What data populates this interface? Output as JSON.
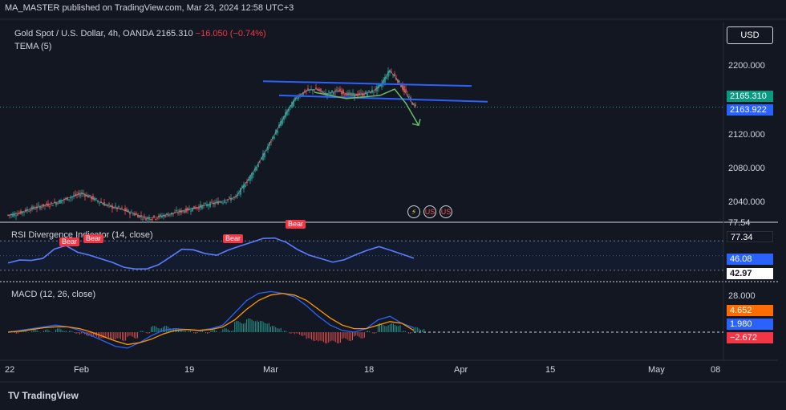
{
  "header": {
    "publisher_line": "MA_MASTER published on TradingView.com, Mar 23, 2024 12:58 UTC+3"
  },
  "legend": {
    "symbol": "Gold Spot / U.S. Dollar, 4h, OANDA",
    "last": "2165.310",
    "change": "−16.050 (−0.74%)",
    "indicator_ema": "TEMA (5)",
    "indicator_rsi": "RSI Divergence Indicator (14, close)",
    "indicator_macd": "MACD (12, 26, close)"
  },
  "currency_button": "USD",
  "price_axis": {
    "ticks": [
      "2200.000",
      "2120.000",
      "2080.000",
      "2040.000"
    ],
    "badge_last": "2165.310",
    "badge_tema": "2163.922"
  },
  "rsi_axis": {
    "top_value": "77.54",
    "badge_a": "77.34",
    "badge_b": "46.08",
    "badge_c": "42.97"
  },
  "macd_axis": {
    "tick": "28.000",
    "badge_macd": "4.652",
    "badge_signal": "1.980",
    "badge_hist": "−2.672"
  },
  "time_axis": [
    "22",
    "Feb",
    "19",
    "Mar",
    "18",
    "Apr",
    "15",
    "May",
    "08"
  ],
  "rsi_labels": [
    "Bear",
    "Bear",
    "Bear",
    "Bear"
  ],
  "brand": {
    "logo": "TV",
    "name": "TradingView"
  },
  "event_icons": [
    "⚡",
    "US",
    "US"
  ],
  "colors": {
    "background": "#131722",
    "bull": "#26a69a",
    "bear": "#ef5350",
    "trendline": "#2962ff",
    "rsi": "#5b7cff",
    "macd": "#2962ff",
    "signal": "#ff9800",
    "last_price_badge": "#089981",
    "tema_badge": "#2962ff",
    "macd_badge": "#ff6d00",
    "hist_badge": "#f23645"
  },
  "chart_data": [
    {
      "type": "candlestick",
      "title": "Gold Spot / U.S. Dollar, 4h, OANDA",
      "x_ticks": [
        "22",
        "Feb",
        "19",
        "Mar",
        "18",
        "Apr",
        "15",
        "May",
        "08"
      ],
      "ylim": [
        2020,
        2240
      ],
      "y_ticks": [
        2200,
        2120,
        2080,
        2040
      ],
      "price_path": [
        [
          0,
          2028
        ],
        [
          6,
          2030
        ],
        [
          14,
          2036
        ],
        [
          22,
          2040
        ],
        [
          30,
          2044
        ],
        [
          38,
          2050
        ],
        [
          46,
          2056
        ],
        [
          54,
          2048
        ],
        [
          62,
          2040
        ],
        [
          70,
          2036
        ],
        [
          78,
          2030
        ],
        [
          86,
          2024
        ],
        [
          94,
          2026
        ],
        [
          102,
          2030
        ],
        [
          110,
          2034
        ],
        [
          118,
          2038
        ],
        [
          126,
          2042
        ],
        [
          134,
          2046
        ],
        [
          142,
          2051
        ],
        [
          150,
          2074
        ],
        [
          158,
          2100
        ],
        [
          166,
          2130
        ],
        [
          174,
          2160
        ],
        [
          180,
          2178
        ],
        [
          186,
          2186
        ],
        [
          192,
          2188
        ],
        [
          198,
          2182
        ],
        [
          206,
          2186
        ],
        [
          214,
          2180
        ],
        [
          222,
          2182
        ],
        [
          228,
          2186
        ],
        [
          232,
          2192
        ],
        [
          238,
          2212
        ],
        [
          244,
          2196
        ],
        [
          250,
          2176
        ],
        [
          254,
          2165
        ]
      ],
      "trendline_upper": [
        2198,
        2192
      ],
      "trendline_lower": [
        2180,
        2172
      ],
      "projection_target": 2142,
      "last_price": 2165.31,
      "tema_value": 2163.922
    },
    {
      "type": "line",
      "title": "RSI Divergence Indicator (14, close)",
      "levels": [
        77.54,
        46.08,
        42.97
      ],
      "values": [
        40,
        42,
        44,
        48,
        58,
        62,
        56,
        52,
        44,
        40,
        36,
        32,
        30,
        38,
        50,
        58,
        56,
        54,
        52,
        56,
        62,
        70,
        74,
        72,
        68,
        60,
        50,
        44,
        42,
        46,
        50,
        56,
        64,
        58,
        50,
        46
      ],
      "signals": [
        "Bear",
        "Bear",
        "Bear",
        "Bear"
      ]
    },
    {
      "type": "line",
      "title": "MACD (12, 26, close)",
      "y_ticks": [
        28
      ],
      "macd": [
        0,
        2,
        4,
        6,
        8,
        6,
        2,
        -4,
        -10,
        -16,
        -18,
        -12,
        -4,
        2,
        4,
        3,
        2,
        4,
        8,
        22,
        36,
        44,
        46,
        44,
        40,
        30,
        18,
        8,
        2,
        0,
        4,
        14,
        18,
        10,
        5
      ],
      "signal": [
        0,
        1,
        3,
        5,
        6,
        6,
        4,
        0,
        -5,
        -10,
        -14,
        -12,
        -8,
        -2,
        2,
        3,
        2,
        3,
        6,
        14,
        26,
        36,
        42,
        44,
        42,
        36,
        26,
        16,
        8,
        4,
        4,
        8,
        12,
        10,
        2
      ],
      "last_macd": 4.652,
      "last_signal": 1.98,
      "last_histogram": -2.672
    }
  ]
}
